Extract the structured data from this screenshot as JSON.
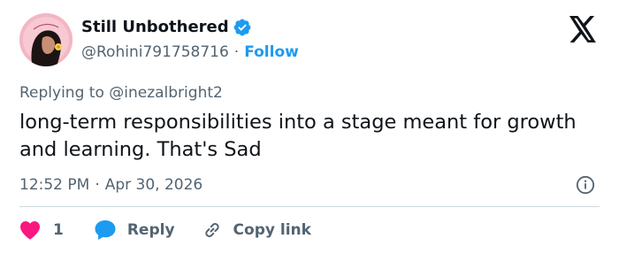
{
  "author": {
    "display_name": "Still Unbothered",
    "handle": "@Rohini791758716",
    "separator": "·",
    "follow_label": "Follow"
  },
  "reply_context": {
    "prefix": "Replying to",
    "handle": "@inezalbright2"
  },
  "tweet": {
    "text": "long-term responsibilities into a stage meant for growth and learning. That's Sad"
  },
  "meta": {
    "time": "12:52 PM",
    "separator": "·",
    "date": "Apr 30, 2026"
  },
  "actions": {
    "like_count": "1",
    "reply_label": "Reply",
    "copy_label": "Copy link"
  },
  "icons": {
    "brand": "x-logo-icon",
    "verified": "verified-badge-icon",
    "info": "info-icon",
    "like": "heart-icon",
    "reply": "speech-bubble-icon",
    "copy": "link-icon"
  },
  "colors": {
    "accent": "#1d9bf0",
    "like": "#f91880",
    "text_primary": "#0f1419",
    "text_secondary": "#536471",
    "divider": "#cfd9de"
  }
}
